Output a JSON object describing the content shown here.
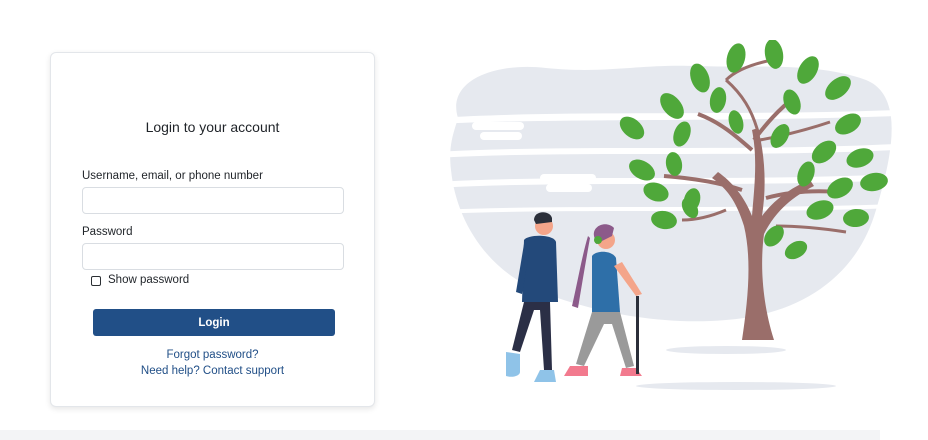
{
  "login": {
    "title": "Login to your account",
    "username_label": "Username, email, or phone number",
    "username_value": "",
    "password_label": "Password",
    "password_value": "",
    "show_password_label": "Show password",
    "show_password_checked": false,
    "login_button_label": "Login",
    "forgot_password_link": "Forgot password?",
    "help_link": "Need help? Contact support"
  },
  "illustration": {
    "icon": "couple-walking-under-tree-illustration"
  },
  "colors": {
    "primary": "#214f87",
    "tree_leaves": "#4fa83a",
    "tree_trunk": "#9a6e6a",
    "background_blob": "#e6e9ef"
  }
}
